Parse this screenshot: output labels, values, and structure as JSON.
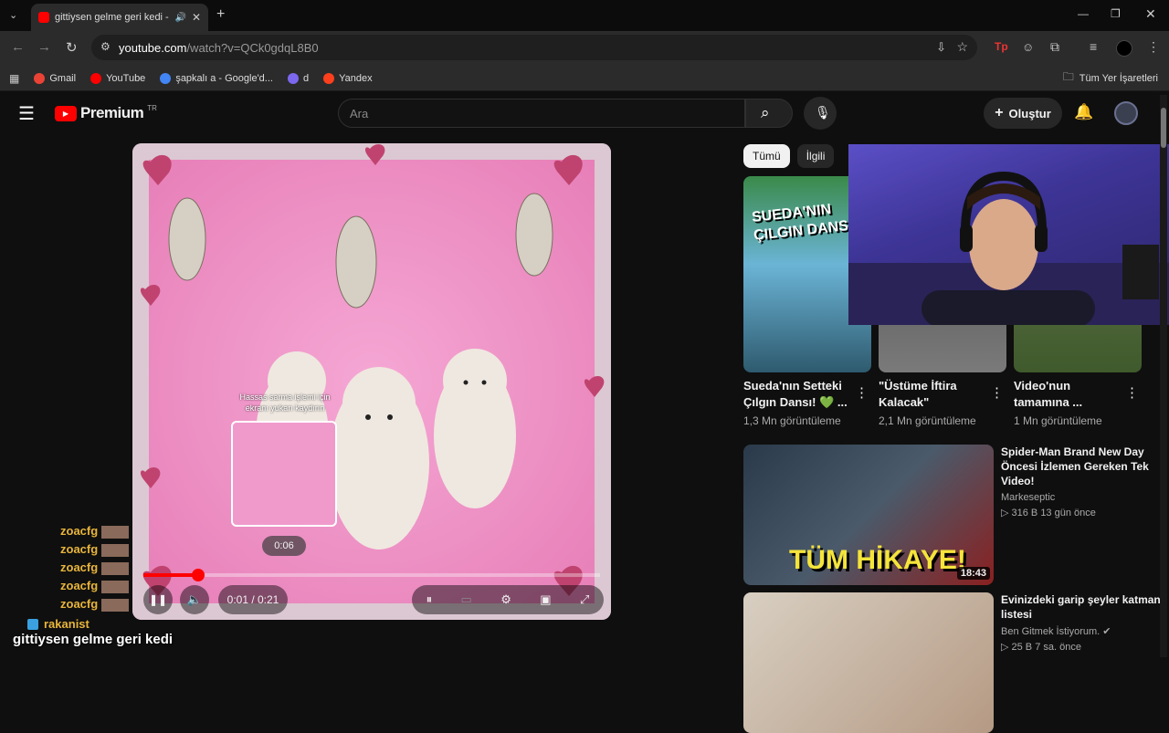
{
  "tab": {
    "title": "gittiysen gelme geri kedi - "
  },
  "url": {
    "host": "youtube.com",
    "path": "/watch?v=QCk0gdqL8B0"
  },
  "bookmarks": [
    {
      "label": "Gmail",
      "color": "#ea4335"
    },
    {
      "label": "YouTube",
      "color": "#ff0000"
    },
    {
      "label": "şapkalı a - Google'd...",
      "color": "#4285f4"
    },
    {
      "label": "d",
      "color": "#7b68ee"
    },
    {
      "label": "Yandex",
      "color": "#fc3f1d"
    }
  ],
  "bookmarks_all": "Tüm Yer İşaretleri",
  "yt": {
    "logo": "Premium",
    "logo_sup": "TR",
    "search_placeholder": "Ara",
    "create_label": "Oluştur"
  },
  "player": {
    "time": "0:01 / 0:21",
    "hover_time": "0:06",
    "preview_hint": "Hassas sarma işlemi için ekranı yukarı kaydırın",
    "progress_fraction": 0.12
  },
  "chips": [
    "Tümü",
    "İlgili"
  ],
  "shorts": [
    {
      "title": "Sueda'nın Setteki Çılgın Dansı! 💚 ...",
      "views": "1,3 Mn görüntüleme",
      "thumb_text": "SUEDA'NIN ÇILGIN DANS"
    },
    {
      "title": "\"Üstüme İftira Kalacak\"",
      "views": "2,1 Mn görüntüleme",
      "thumb_text": ""
    },
    {
      "title": "Video'nun tamamına ...",
      "views": "1 Mn görüntüleme",
      "thumb_text": ""
    }
  ],
  "videos": [
    {
      "title": "Spider-Man Brand New Day Öncesi İzlemen Gereken Tek Video!",
      "channel": "Markeseptic",
      "stats": "▷ 316 B  13 gün önce",
      "duration": "18:43",
      "thumb_text": "TÜM HİKAYE!"
    },
    {
      "title": "Evinizdeki garip şeyler katman listesi",
      "channel": "Ben Gitmek İstiyorum.",
      "stats": "▷ 25 B  7 sa. önce",
      "duration": "",
      "thumb_text": ""
    }
  ],
  "chat": [
    "zoacfg",
    "zoacfg",
    "zoacfg",
    "zoacfg",
    "zoacfg"
  ],
  "overlay": {
    "user": "rakanist",
    "caption": "gittiysen gelme geri kedi"
  }
}
